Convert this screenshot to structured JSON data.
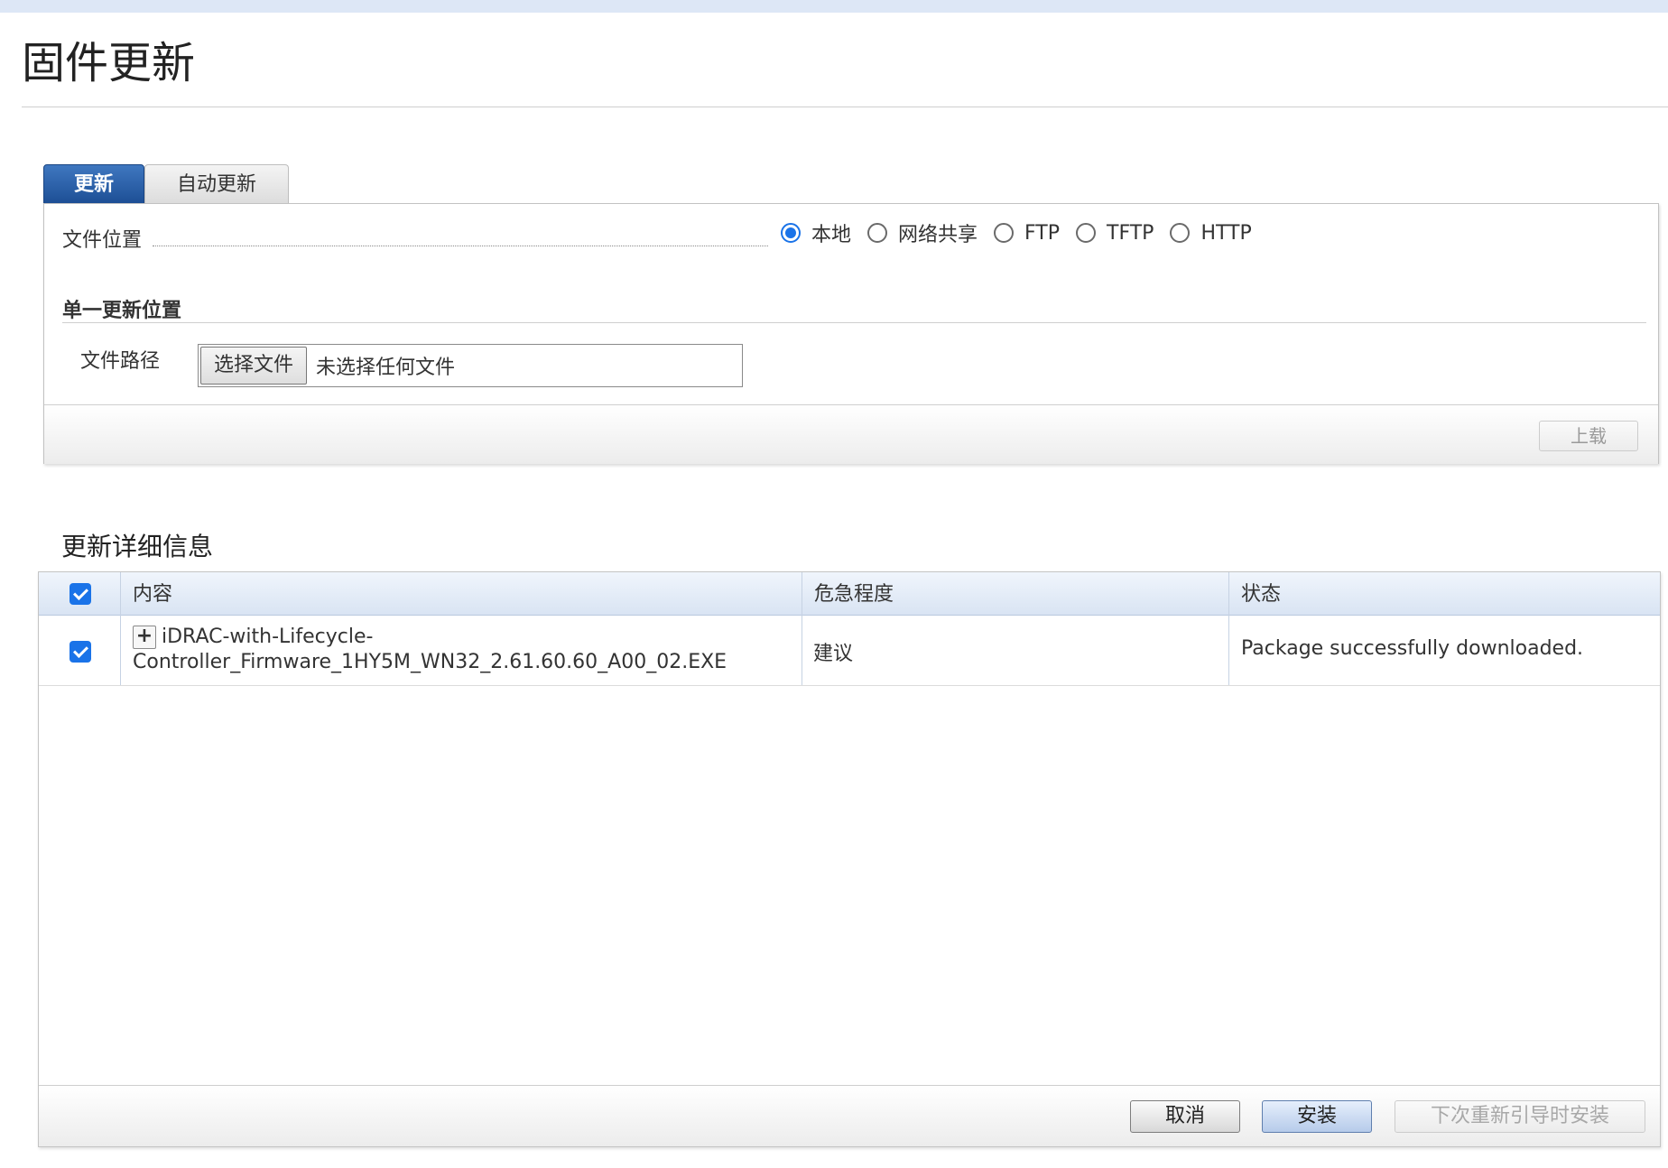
{
  "page": {
    "title": "固件更新"
  },
  "tabs": [
    {
      "label": "更新",
      "active": true
    },
    {
      "label": "自动更新",
      "active": false
    }
  ],
  "upload": {
    "file_location_label": "文件位置",
    "location_options": [
      {
        "label": "本地",
        "checked": true
      },
      {
        "label": "网络共享",
        "checked": false
      },
      {
        "label": "FTP",
        "checked": false
      },
      {
        "label": "TFTP",
        "checked": false
      },
      {
        "label": "HTTP",
        "checked": false
      }
    ],
    "single_update_heading": "单一更新位置",
    "file_path_label": "文件路径",
    "choose_file_label": "选择文件",
    "no_file_text": "未选择任何文件",
    "upload_button": "上载"
  },
  "details": {
    "title": "更新详细信息",
    "columns": [
      "内容",
      "危急程度",
      "状态"
    ],
    "header_checked": true,
    "rows": [
      {
        "checked": true,
        "content_line1": "iDRAC-with-Lifecycle-",
        "content_line2": "Controller_Firmware_1HY5M_WN32_2.61.60.60_A00_02.EXE",
        "criticality": "建议",
        "status": "Package successfully downloaded."
      }
    ],
    "buttons": {
      "cancel": "取消",
      "install": "安装",
      "install_next_boot": "下次重新引导时安装"
    }
  },
  "colors": {
    "tab_active": "#1d4f95",
    "accent": "#1a73e8",
    "header_bg": "#d9e4f3"
  }
}
